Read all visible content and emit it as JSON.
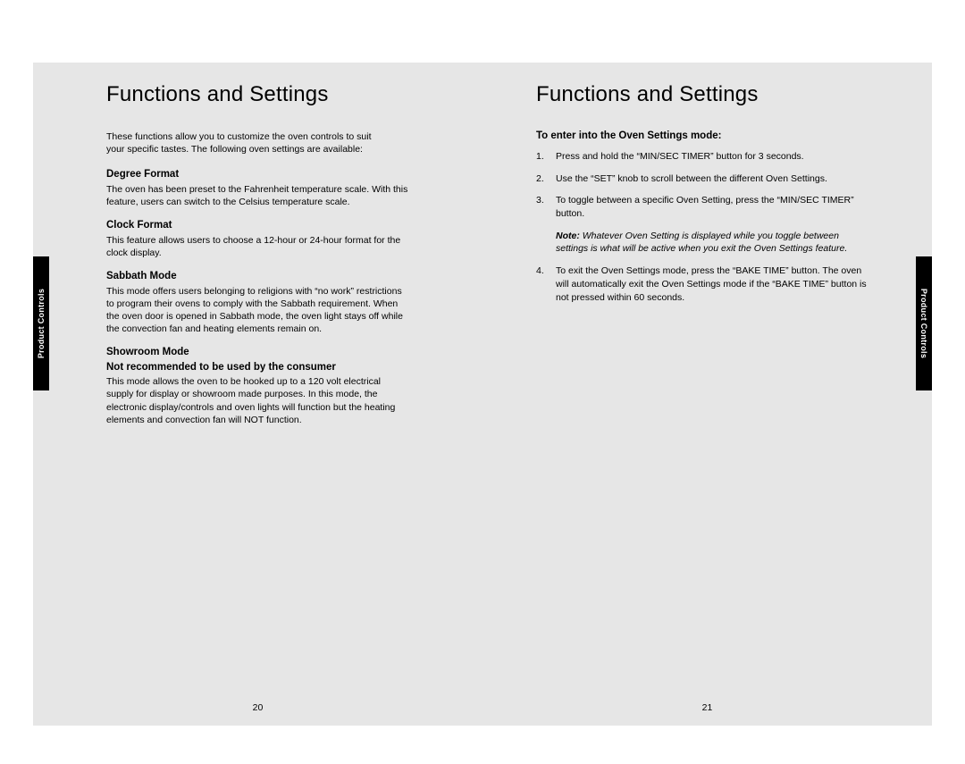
{
  "sideTab": "Product Controls",
  "leftPage": {
    "title": "Functions and Settings",
    "intro": "These functions allow you to customize the oven controls to suit your specific tastes. The following oven settings are available:",
    "sections": [
      {
        "head": "Degree Format",
        "body": "The oven has been preset to the Fahrenheit temperature scale. With this feature, users can switch to the Celsius temperature scale."
      },
      {
        "head": "Clock Format",
        "body": "This feature allows users to choose a 12-hour or 24-hour format for the clock display."
      },
      {
        "head": "Sabbath Mode",
        "body": "This mode offers users belonging to religions with “no work” restrictions to program their ovens to comply with the Sabbath requirement. When the oven door is opened in Sabbath mode, the oven light stays off while the convection fan and heating elements remain on."
      },
      {
        "head": "Showroom Mode",
        "subhead": "Not recommended to be used by the consumer",
        "body": "This mode allows the oven to be hooked up to a 120 volt electrical supply for display or showroom made purposes. In this mode, the electronic display/controls and oven lights will function but the heating elements and convection fan will NOT function."
      }
    ],
    "pageNumber": "20"
  },
  "rightPage": {
    "title": "Functions and Settings",
    "subhead": "To enter into the Oven Settings mode:",
    "steps": [
      "Press and hold the “MIN/SEC TIMER” button for 3 seconds.",
      "Use the “SET” knob to scroll between the different Oven Settings.",
      "To toggle between a specific Oven Setting, press the “MIN/SEC TIMER” button."
    ],
    "noteLabel": "Note:",
    "noteBody": "Whatever Oven Setting is displayed while you toggle between settings is what will be active when you exit the Oven Settings feature.",
    "step4": "To exit the Oven Settings mode, press the “BAKE TIME” button. The oven will automatically exit the Oven Settings mode if the “BAKE TIME” button is not pressed within 60 seconds.",
    "pageNumber": "21"
  }
}
